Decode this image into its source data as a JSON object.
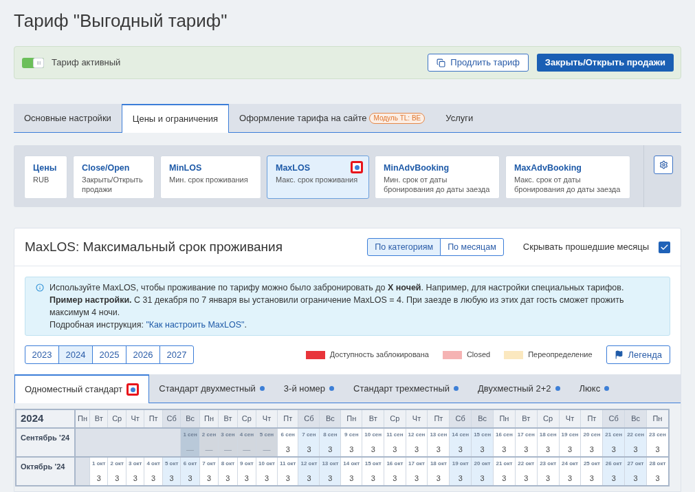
{
  "title": "Тариф \"Выгодный тариф\"",
  "tariff_status": {
    "toggle": {
      "on": true
    },
    "label": "Тариф активный",
    "buttons": [
      {
        "kind": "outline",
        "label": "Продлить тариф"
      },
      {
        "kind": "primary",
        "label": "Закрыть/Открыть продажи"
      }
    ]
  },
  "tabs": [
    {
      "label": "Основные настройки",
      "selected": false
    },
    {
      "label": "Цены и ограничения",
      "selected": true
    },
    {
      "label": "Оформление тарифа на сайте",
      "badge": "Модуль TL: BE",
      "selected": false
    },
    {
      "label": "Услуги",
      "selected": false
    }
  ],
  "restriction_cards": [
    {
      "title": "Цены",
      "subtitle": "RUB",
      "selected": false,
      "dot": false
    },
    {
      "title": "Close/Open",
      "subtitle": "Закрыть/Открыть продажи",
      "selected": false,
      "dot": false
    },
    {
      "title": "MinLOS",
      "subtitle": "Мин. срок проживания",
      "selected": false,
      "dot": false
    },
    {
      "title": "MaxLOS",
      "subtitle": "Макс. срок проживания",
      "selected": true,
      "dot": true
    },
    {
      "title": "MinAdvBooking",
      "subtitle": "Мин. срок от даты бронирования до даты заезда",
      "selected": false,
      "dot": false
    },
    {
      "title": "MaxAdvBooking",
      "subtitle": "Макс. срок от даты бронирования до даты заезда",
      "selected": false,
      "dot": false
    }
  ],
  "panel": {
    "title": "MaxLOS: Максимальный срок проживания",
    "view_toggle": [
      {
        "label": "По категориям",
        "selected": true
      },
      {
        "label": "По месяцам",
        "selected": false
      }
    ],
    "hide_past": {
      "label": "Скрывать прошедшие месяцы",
      "checked": true
    }
  },
  "info": {
    "paragraphs": [
      "Используйте MaxLOS, чтобы проживание по тарифу можно было забронировать до **X ночей**. Например, для настройки специальных тарифов.",
      "**Пример настройки.** С 31 декабря по 7 января вы установили ограничение MaxLOS = 4. При заезде в любую из этих дат гость сможет прожить максимум 4 ночи."
    ],
    "instruction": {
      "text": "Подробная инструкция:",
      "link": "\"Как настроить MaxLOS\"",
      "suffix": "."
    }
  },
  "years": [
    {
      "label": "2023",
      "selected": false
    },
    {
      "label": "2024",
      "selected": true
    },
    {
      "label": "2025",
      "selected": false
    },
    {
      "label": "2026",
      "selected": false
    },
    {
      "label": "2027",
      "selected": false
    }
  ],
  "legend": [
    {
      "label": "Доступность заблокирована",
      "color": "#e8343a"
    },
    {
      "label": "Closed",
      "color": "#f5b3b3"
    },
    {
      "label": "Переопределение",
      "color": "#fbe8bf"
    }
  ],
  "legend_button": "Легенда",
  "room_tabs": [
    {
      "label": "Одноместный стандарт",
      "selected": true,
      "highlighted": true
    },
    {
      "label": "Стандарт двухместный",
      "selected": false,
      "highlighted": false
    },
    {
      "label": "3-й номер",
      "selected": false,
      "highlighted": false
    },
    {
      "label": "Стандарт трехместный",
      "selected": false,
      "highlighted": false
    },
    {
      "label": "Двухместный 2+2",
      "selected": false,
      "highlighted": false
    },
    {
      "label": "Люкс",
      "selected": false,
      "highlighted": false
    }
  ],
  "calendar": {
    "year": "2024",
    "weekdays": [
      {
        "label": "Пн",
        "weekend": false
      },
      {
        "label": "Вт",
        "weekend": false
      },
      {
        "label": "Ср",
        "weekend": false
      },
      {
        "label": "Чт",
        "weekend": false
      },
      {
        "label": "Пт",
        "weekend": false
      },
      {
        "label": "Сб",
        "weekend": true
      },
      {
        "label": "Вс",
        "weekend": true
      },
      {
        "label": "Пн",
        "weekend": false
      },
      {
        "label": "Вт",
        "weekend": false
      },
      {
        "label": "Ср",
        "weekend": false
      },
      {
        "label": "Чт",
        "weekend": false
      },
      {
        "label": "Пт",
        "weekend": false
      },
      {
        "label": "Сб",
        "weekend": true
      },
      {
        "label": "Вс",
        "weekend": true
      },
      {
        "label": "Пн",
        "weekend": false
      },
      {
        "label": "Вт",
        "weekend": false
      },
      {
        "label": "Ср",
        "weekend": false
      },
      {
        "label": "Чт",
        "weekend": false
      },
      {
        "label": "Пт",
        "weekend": false
      },
      {
        "label": "Сб",
        "weekend": true
      },
      {
        "label": "Вс",
        "weekend": true
      },
      {
        "label": "Пн",
        "weekend": false
      },
      {
        "label": "Вт",
        "weekend": false
      },
      {
        "label": "Ср",
        "weekend": false
      },
      {
        "label": "Чт",
        "weekend": false
      },
      {
        "label": "Пт",
        "weekend": false
      },
      {
        "label": "Сб",
        "weekend": true
      },
      {
        "label": "Вс",
        "weekend": true
      },
      {
        "label": "Пн",
        "weekend": false
      }
    ],
    "months": [
      {
        "label": "Сентябрь ’24",
        "days": [
          {
            "date": "1 сен",
            "value": "—",
            "past": true
          },
          {
            "date": "2 сен",
            "value": "—",
            "past": true
          },
          {
            "date": "3 сен",
            "value": "—",
            "past": true
          },
          {
            "date": "4 сен",
            "value": "—",
            "past": true
          },
          {
            "date": "5 сен",
            "value": "—",
            "past": true
          },
          {
            "date": "6 сен",
            "value": "3",
            "past": false
          },
          {
            "date": "7 сен",
            "value": "3",
            "past": false
          },
          {
            "date": "8 сен",
            "value": "3",
            "past": false
          },
          {
            "date": "9 сен",
            "value": "3",
            "past": false
          },
          {
            "date": "10 сен",
            "value": "3",
            "past": false
          },
          {
            "date": "11 сен",
            "value": "3",
            "past": false
          },
          {
            "date": "12 сен",
            "value": "3",
            "past": false
          },
          {
            "date": "13 сен",
            "value": "3",
            "past": false
          },
          {
            "date": "14 сен",
            "value": "3",
            "past": false
          },
          {
            "date": "15 сен",
            "value": "3",
            "past": false
          },
          {
            "date": "16 сен",
            "value": "3",
            "past": false
          },
          {
            "date": "17 сен",
            "value": "3",
            "past": false
          },
          {
            "date": "18 сен",
            "value": "3",
            "past": false
          },
          {
            "date": "19 сен",
            "value": "3",
            "past": false
          },
          {
            "date": "20 сен",
            "value": "3",
            "past": false
          },
          {
            "date": "21 сен",
            "value": "3",
            "past": false
          },
          {
            "date": "22 сен",
            "value": "3",
            "past": false
          },
          {
            "date": "23 сен",
            "value": "3",
            "past": false
          }
        ]
      },
      {
        "label": "Октябрь ’24",
        "days": [
          {
            "date": "1 окт",
            "value": "3",
            "past": false
          },
          {
            "date": "2 окт",
            "value": "3",
            "past": false
          },
          {
            "date": "3 окт",
            "value": "3",
            "past": false
          },
          {
            "date": "4 окт",
            "value": "3",
            "past": false
          },
          {
            "date": "5 окт",
            "value": "3",
            "past": false
          },
          {
            "date": "6 окт",
            "value": "3",
            "past": false
          },
          {
            "date": "7 окт",
            "value": "3",
            "past": false
          },
          {
            "date": "8 окт",
            "value": "3",
            "past": false
          },
          {
            "date": "9 окт",
            "value": "3",
            "past": false
          },
          {
            "date": "10 окт",
            "value": "3",
            "past": false
          },
          {
            "date": "11 окт",
            "value": "3",
            "past": false
          },
          {
            "date": "12 окт",
            "value": "3",
            "past": false
          },
          {
            "date": "13 окт",
            "value": "3",
            "past": false
          },
          {
            "date": "14 окт",
            "value": "3",
            "past": false
          },
          {
            "date": "15 окт",
            "value": "3",
            "past": false
          },
          {
            "date": "16 окт",
            "value": "3",
            "past": false
          },
          {
            "date": "17 окт",
            "value": "3",
            "past": false
          },
          {
            "date": "18 окт",
            "value": "3",
            "past": false
          },
          {
            "date": "19 окт",
            "value": "3",
            "past": false
          },
          {
            "date": "20 окт",
            "value": "3",
            "past": false
          },
          {
            "date": "21 окт",
            "value": "3",
            "past": false
          },
          {
            "date": "22 окт",
            "value": "3",
            "past": false
          },
          {
            "date": "23 окт",
            "value": "3",
            "past": false
          },
          {
            "date": "24 окт",
            "value": "3",
            "past": false
          },
          {
            "date": "25 окт",
            "value": "3",
            "past": false
          },
          {
            "date": "26 окт",
            "value": "3",
            "past": false
          },
          {
            "date": "27 окт",
            "value": "3",
            "past": false
          },
          {
            "date": "28 окт",
            "value": "3",
            "past": false
          }
        ]
      }
    ]
  }
}
